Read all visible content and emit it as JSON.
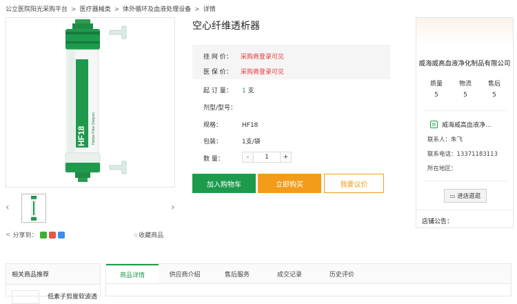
{
  "breadcrumb": [
    "公立医院阳光采购平台",
    "医疗器械类",
    "体外循环及血液处理设备",
    "详情"
  ],
  "breadcrumb_sep": ">",
  "product": {
    "title": "空心纤维透析器",
    "image_text": "HF18",
    "image_subtext": "Hollow Fiber Dialyzer",
    "listed_price_label": "挂 网 价：",
    "listed_price_value": "采购商登录可见",
    "insurance_price_label": "医 保 价：",
    "insurance_price_value": "采购商登录可见",
    "moq_label": "起 订 量：",
    "moq_value": "1",
    "moq_unit": "支",
    "model_label": "剂型/型号：",
    "spec_label": "规格：",
    "spec_value": "HF18",
    "packing_label": "包装：",
    "packing_value": "1支/袋",
    "qty_label": "数    量：",
    "qty_minus": "-",
    "qty_value": "1",
    "qty_plus": "+"
  },
  "actions": {
    "add_cart": "加入购物车",
    "buy_now": "立即购买",
    "negotiate": "我要议价"
  },
  "share": {
    "label": "分享到：",
    "favorite": "收藏商品"
  },
  "store": {
    "name": "威海威高血液净化制品有限公司",
    "ratings": [
      {
        "label": "质量",
        "value": "5"
      },
      {
        "label": "物流",
        "value": "5"
      },
      {
        "label": "售后",
        "value": "5"
      }
    ],
    "shop_icon": "供",
    "shop_name": "威海威高血液净...",
    "contact": "联系人：朱飞",
    "phone": "联系电话：13371183113",
    "region": "所在地区：",
    "enter": "进店逛逛",
    "notice": "店铺公告："
  },
  "related": {
    "title": "相关商品推荐",
    "item": "低素子剪度软波透"
  },
  "tabs": [
    "商品详情",
    "供应商介绍",
    "售后服务",
    "成交记录",
    "历史评价"
  ],
  "colors": {
    "green": "#1e9a4d",
    "orange": "#f39c1a",
    "red": "#e4393c"
  }
}
